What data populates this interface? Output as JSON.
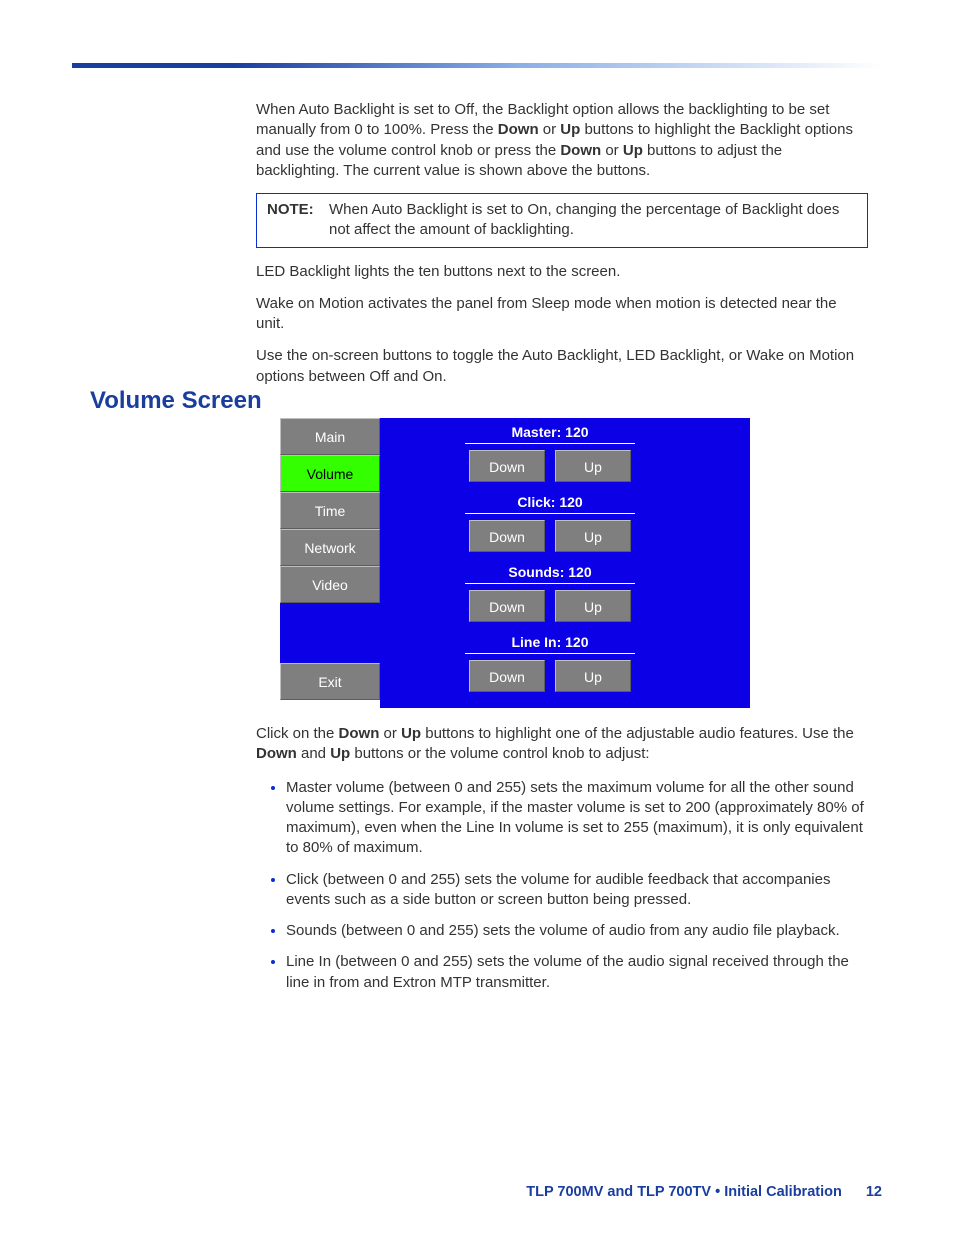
{
  "body": {
    "p1a": "When Auto Backlight is set to Off, the Backlight option allows the backlighting to be set manually from 0 to 100%. Press the ",
    "down": "Down",
    "or": " or ",
    "up": "Up",
    "p1b": " buttons to highlight the Backlight options and use the volume control knob or press the ",
    "p1c": " buttons to adjust the backlighting. The current value is shown above the buttons.",
    "note_label": "NOTE:",
    "note_text": "When Auto Backlight is set to On, changing the percentage of Backlight does not affect the amount of backlighting.",
    "p2": "LED Backlight lights the ten buttons next to the screen.",
    "p3": "Wake on Motion activates the panel from Sleep mode when motion is detected near the unit.",
    "p4": "Use the on-screen buttons to toggle the Auto Backlight, LED Backlight, or Wake on Motion options between Off and On."
  },
  "section_heading": "Volume Screen",
  "panel": {
    "side": [
      "Main",
      "Volume",
      "Time",
      "Network",
      "Video"
    ],
    "selected_index": 1,
    "exit": "Exit",
    "groups": [
      {
        "label": "Master: 120",
        "down": "Down",
        "up": "Up"
      },
      {
        "label": "Click: 120",
        "down": "Down",
        "up": "Up"
      },
      {
        "label": "Sounds: 120",
        "down": "Down",
        "up": "Up"
      },
      {
        "label": "Line In: 120",
        "down": "Down",
        "up": "Up"
      }
    ]
  },
  "body2": {
    "p5a": "Click on the ",
    "p5b": " buttons to highlight one of the adjustable audio features. Use the ",
    "and": " and ",
    "p5c": " buttons or the volume control knob to adjust:",
    "bullet1": "Master volume (between 0 and 255) sets the maximum volume for all the other sound volume settings. For example, if the master volume is set to 200 (approximately 80% of maximum), even when the Line In volume is set to 255 (maximum), it is only equivalent to 80% of maximum.",
    "bullet2": "Click (between 0 and 255) sets the volume for audible feedback that accompanies events such as a side button or screen button being pressed.",
    "bullet3": "Sounds (between 0 and 255) sets the volume of audio from any audio file playback.",
    "bullet4": "Line In (between 0 and 255) sets the volume of the audio signal received through the line in from and Extron MTP transmitter."
  },
  "footer": {
    "title": "TLP 700MV and TLP 700TV • Initial Calibration",
    "page": "12"
  }
}
